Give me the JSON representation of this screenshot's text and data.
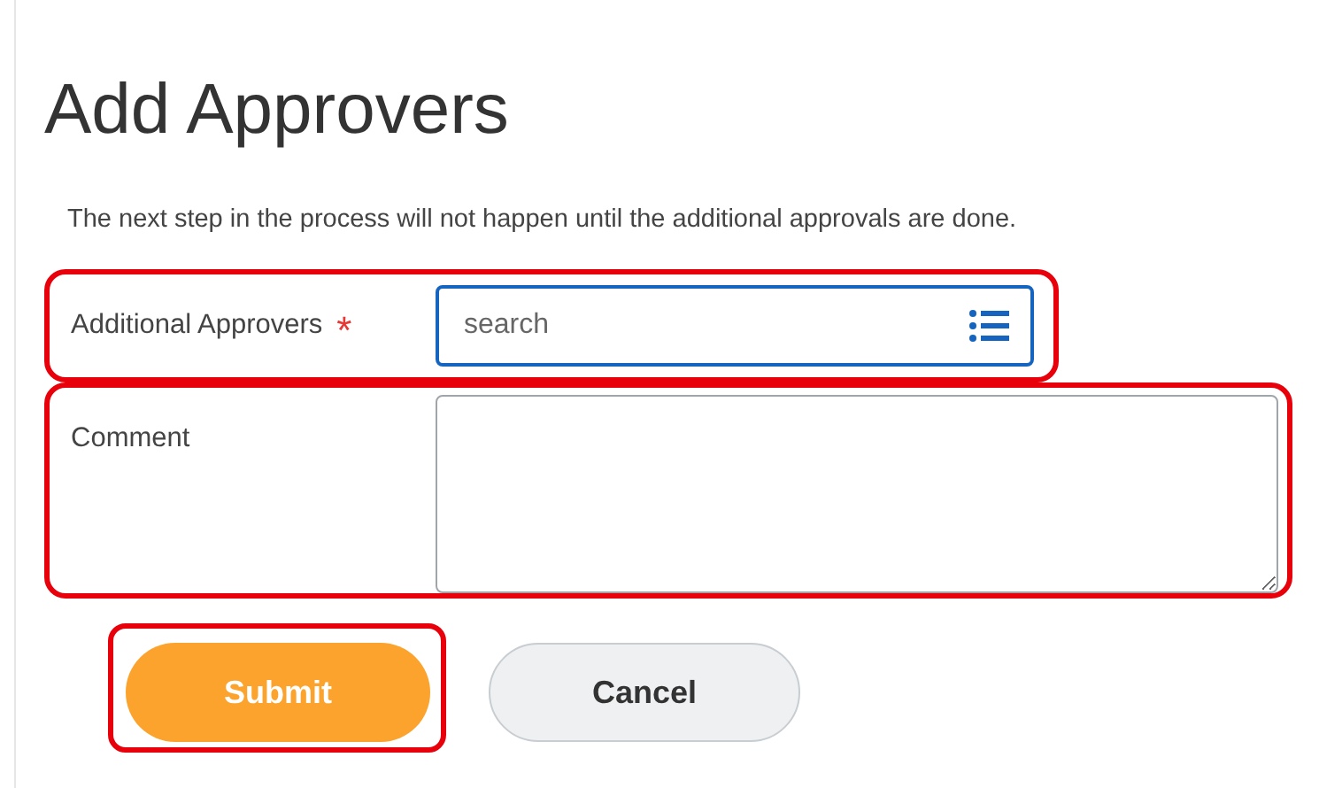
{
  "title": "Add Approvers",
  "description": "The next step in the process will not happen until the additional approvals are done.",
  "fields": [
    {
      "kind": "search",
      "label": "Approvers",
      "label_prefix": "Additional",
      "required_mark": "*",
      "placeholder": "search",
      "focused": true,
      "highlighted": true
    },
    {
      "kind": "textarea",
      "label": "Comment",
      "focused": false,
      "highlighted": true
    }
  ],
  "buttons": [
    {
      "label": "Submit",
      "primary": true,
      "highlighted": true
    },
    {
      "label": "Cancel",
      "primary": false,
      "highlighted": false
    }
  ]
}
